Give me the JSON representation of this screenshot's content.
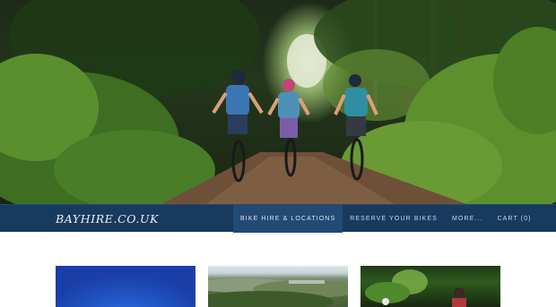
{
  "hero": {
    "image": "mountain-bikers-forest-trail-photo"
  },
  "header": {
    "logo_text": "BAYHIRE.CO.UK"
  },
  "nav": {
    "items": [
      {
        "label": "BIKE HIRE & LOCATIONS",
        "active": true
      },
      {
        "label": "RESERVE YOUR BIKES",
        "active": false
      },
      {
        "label": "MORE...",
        "active": false
      },
      {
        "label": "CART (0)",
        "active": false
      }
    ]
  },
  "thumbnails": [
    {
      "image": "blue-sky-photo"
    },
    {
      "image": "countryside-landscape-photo"
    },
    {
      "image": "cyclist-in-woods-photo"
    }
  ],
  "colors": {
    "navbar": "#193a5f",
    "nav_active": "#234a73",
    "nav_text": "#c9d6e6",
    "logo_text": "#e9eef5",
    "page_background": "#ffffff"
  }
}
